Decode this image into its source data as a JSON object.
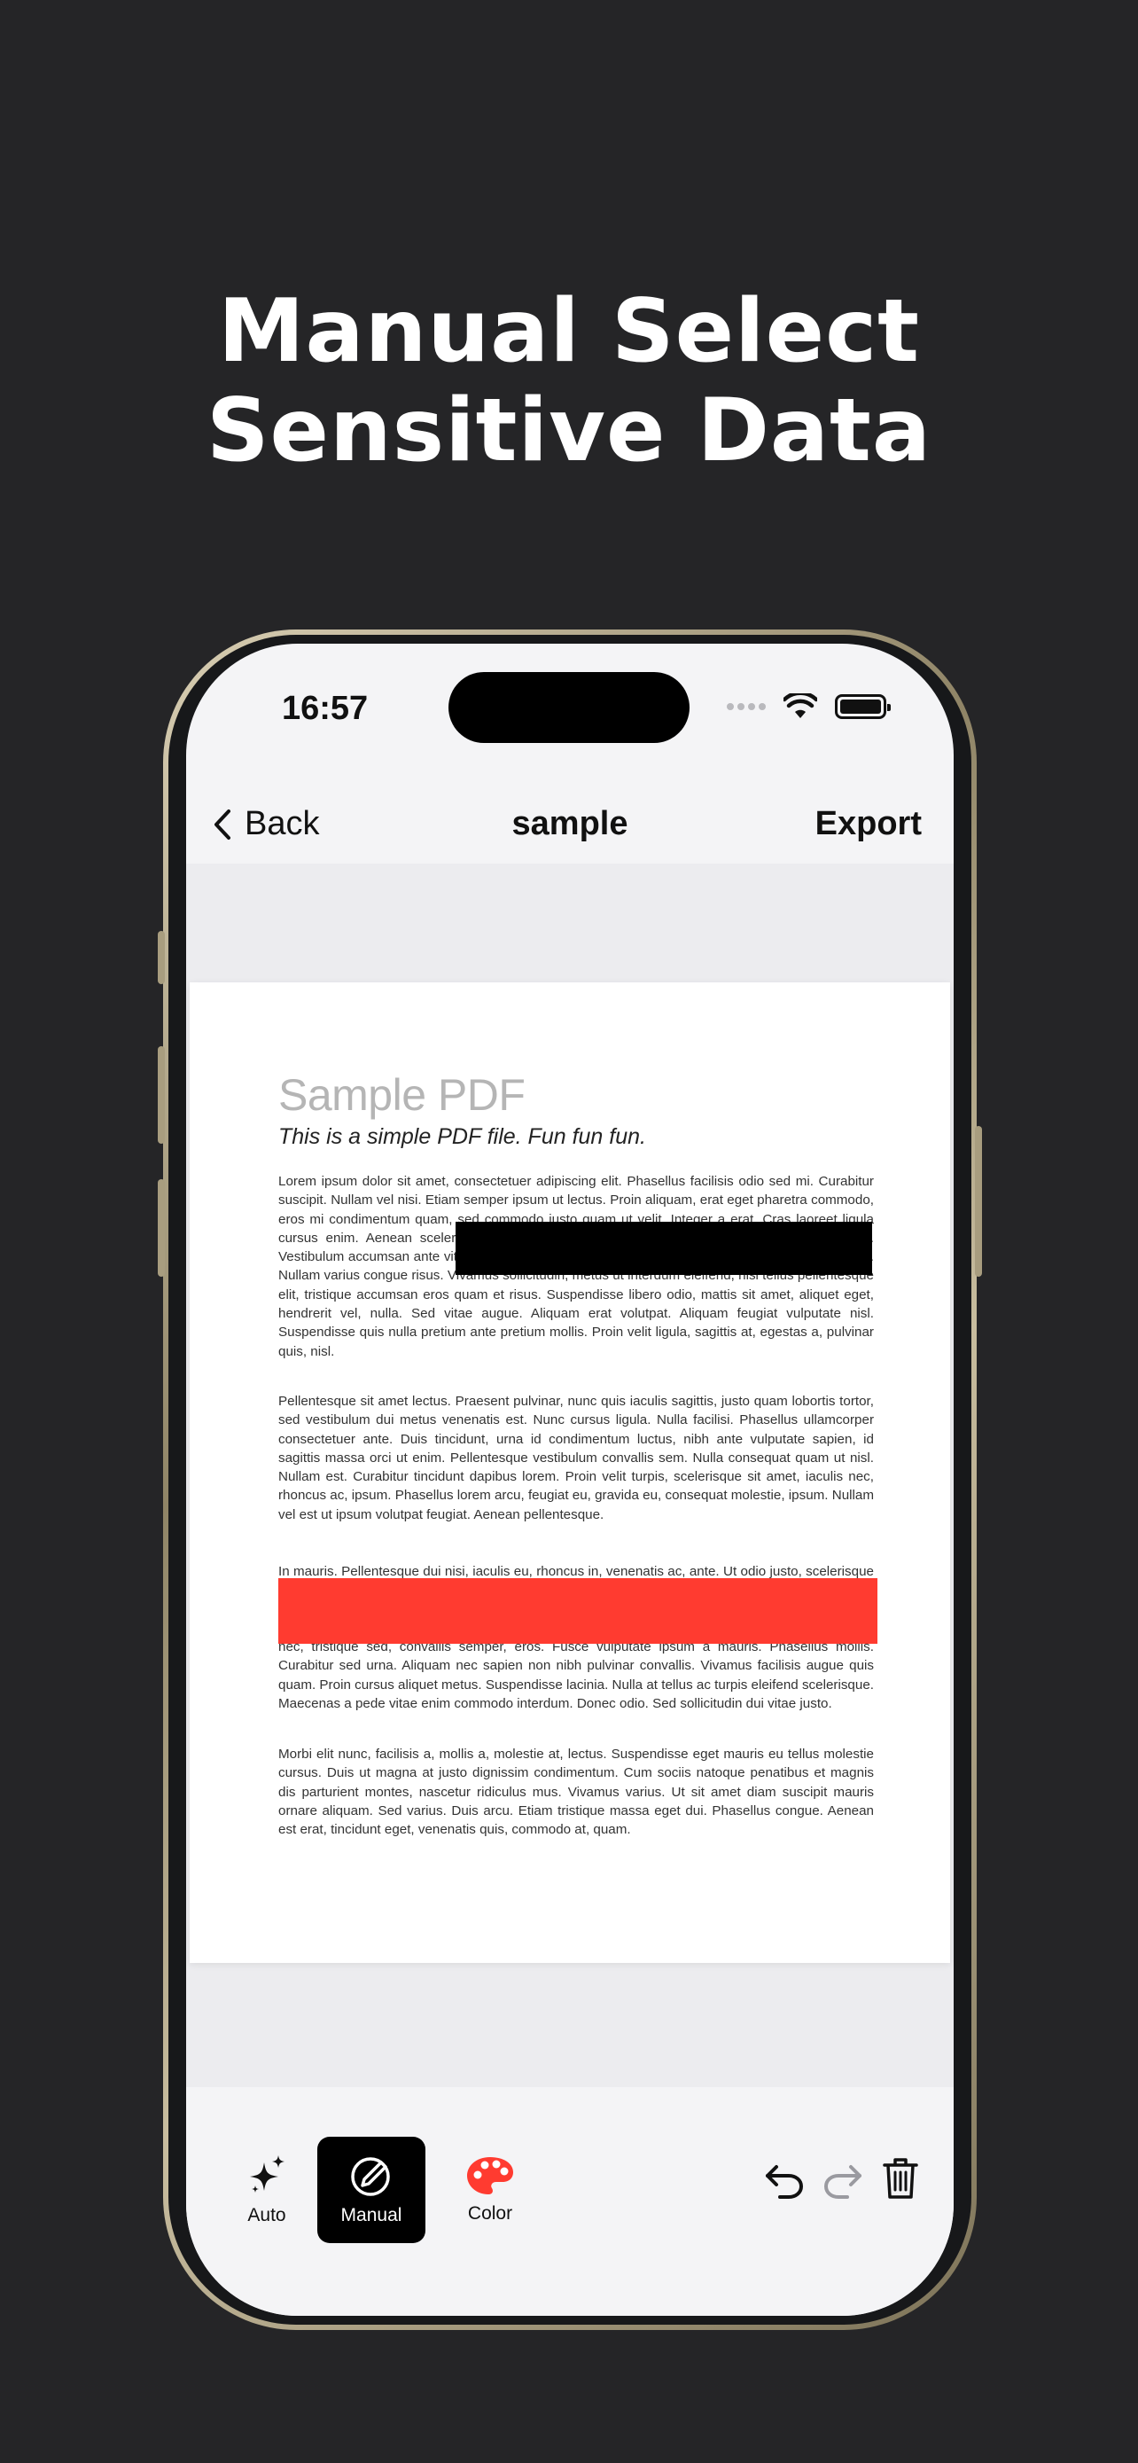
{
  "headline": {
    "line1": "Manual Select",
    "line2": "Sensitive Data"
  },
  "status_bar": {
    "time": "16:57",
    "icons": [
      "cellular-dots-icon",
      "wifi-icon",
      "battery-icon"
    ]
  },
  "nav": {
    "back_label": "Back",
    "title": "sample",
    "export_label": "Export"
  },
  "pdf": {
    "title": "Sample PDF",
    "subtitle": "This is a simple PDF file. Fun fun fun.",
    "paragraphs": [
      "Lorem ipsum dolor sit amet, consectetuer adipiscing elit. Phasellus facilisis odio sed mi. Curabitur suscipit. Nullam vel nisi. Etiam semper ipsum ut lectus. Proin aliquam, erat eget pharetra commodo, eros mi condimentum quam, sed commodo justo quam ut velit. Integer a erat. Cras laoreet ligula cursus enim. Aenean scelerisque velit et tellus. Vestibulum dictum aliquet sem. Nulla facilisi. Vestibulum accumsan ante vitae elit. Nulla erat dolor, blandit in, rutrum quis, semper pulvinar, enim. Nullam varius congue risus. Vivamus sollicitudin, metus ut interdum eleifend, nisi tellus pellentesque elit, tristique accumsan eros quam et risus. Suspendisse libero odio, mattis sit amet, aliquet eget, hendrerit vel, nulla. Sed vitae augue. Aliquam erat volutpat. Aliquam feugiat vulputate nisl. Suspendisse quis nulla pretium ante pretium mollis. Proin velit ligula, sagittis at, egestas a, pulvinar quis, nisl.",
      "Pellentesque sit amet lectus. Praesent pulvinar, nunc quis iaculis sagittis, justo quam lobortis tortor, sed vestibulum dui metus venenatis est. Nunc cursus ligula. Nulla facilisi. Phasellus ullamcorper consectetuer ante. Duis tincidunt, urna id condimentum luctus, nibh ante vulputate sapien, id sagittis massa orci ut enim. Pellentesque vestibulum convallis sem. Nulla consequat quam ut nisl. Nullam est. Curabitur tincidunt dapibus lorem. Proin velit turpis, scelerisque sit amet, iaculis nec, rhoncus ac, ipsum. Phasellus lorem arcu, feugiat eu, gravida eu, consequat molestie, ipsum. Nullam vel est ut ipsum volutpat feugiat. Aenean pellentesque.",
      "In mauris. Pellentesque dui nisi, iaculis eu, rhoncus in, venenatis ac, ante. Ut odio justo, scelerisque vel, facilisis non, commodo a, pede. Cras nec massa sit amet tortor volutpat varius. Donec lacinia, neque a luctus aliquet, pede massa imperdiet ante, at varius lorem pede sed sapien. Fusce erat nibh, aliquet in, eleifend eget, commodo eget, erat. Fusce consectetuer. Cras risus tortor, porttitor nec, tristique sed, convallis semper, eros. Fusce vulputate ipsum a mauris. Phasellus mollis. Curabitur sed urna. Aliquam nec sapien non nibh pulvinar convallis. Vivamus facilisis augue quis quam. Proin cursus aliquet metus. Suspendisse lacinia. Nulla at tellus ac turpis eleifend scelerisque. Maecenas a pede vitae enim commodo interdum. Donec odio. Sed sollicitudin dui vitae justo.",
      "Morbi elit nunc, facilisis a, mollis a, molestie at, lectus. Suspendisse eget mauris eu tellus molestie cursus. Duis ut magna at justo dignissim condimentum. Cum sociis natoque penatibus et magnis dis parturient montes, nascetur ridiculus mus. Vivamus varius. Ut sit amet diam suscipit mauris ornare aliquam. Sed varius. Duis arcu. Etiam tristique massa eget dui. Phasellus congue. Aenean est erat, tincidunt eget, venenatis quis, commodo at, quam."
    ],
    "redaction_colors": {
      "black": "#000000",
      "red": "#ff3b30"
    }
  },
  "toolbar": {
    "auto_label": "Auto",
    "manual_label": "Manual",
    "color_label": "Color",
    "active_tool": "Manual",
    "icons": [
      "sparkles-icon",
      "pencil-circle-icon",
      "palette-icon",
      "undo-icon",
      "redo-icon",
      "trash-icon"
    ]
  },
  "colors": {
    "background": "#252527",
    "accent_red": "#ff3b30",
    "palette_red": "#ff3b30"
  }
}
